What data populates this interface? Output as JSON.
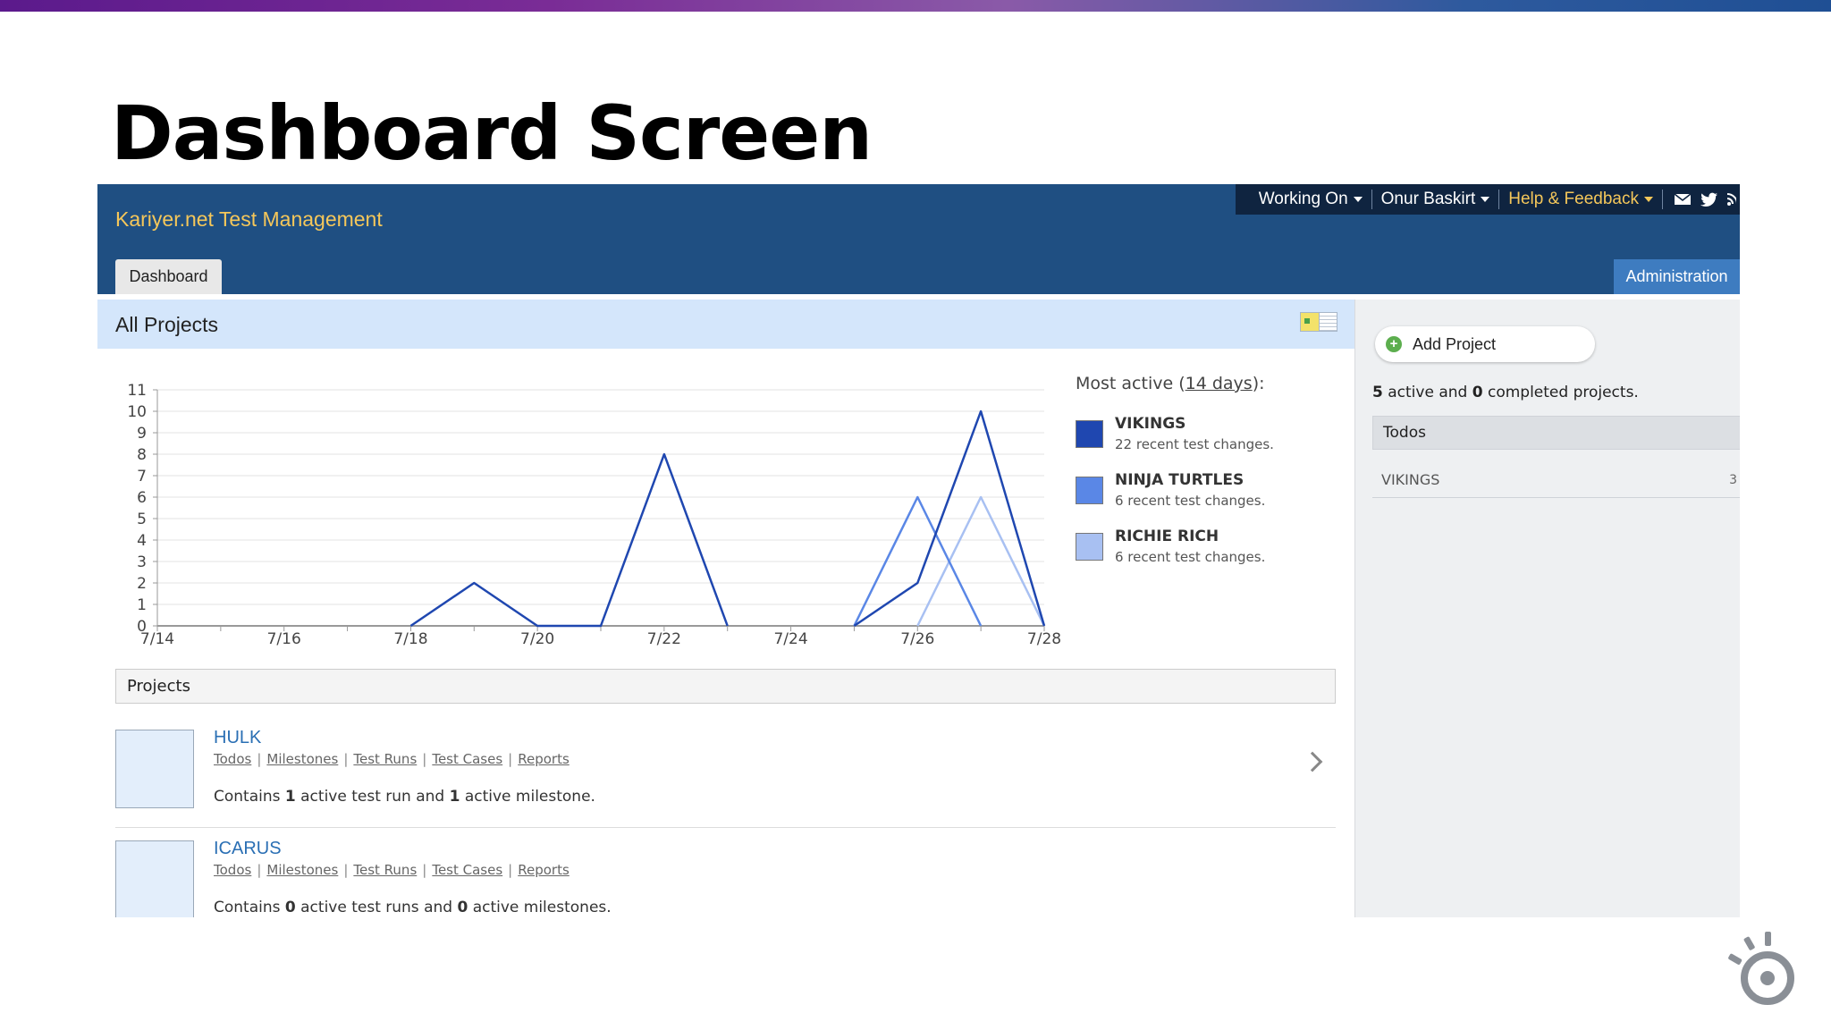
{
  "slide": {
    "title": "Dashboard Screen"
  },
  "app": {
    "name": "Kariyer.net Test Management",
    "topnav": {
      "working_on": "Working On",
      "user": "Onur Baskirt",
      "help": "Help & Feedback"
    },
    "tabs": {
      "dashboard": "Dashboard",
      "administration": "Administration"
    },
    "section_title": "All Projects"
  },
  "legend": {
    "prefix": "Most active (",
    "period": "14 days",
    "suffix": "):",
    "entries": [
      {
        "name": "VIKINGS",
        "changes": "22 recent test changes.",
        "color": "#1f47b0"
      },
      {
        "name": "NINJA TURTLES",
        "changes": "6 recent test changes.",
        "color": "#5a87e6"
      },
      {
        "name": "RICHIE RICH",
        "changes": "6 recent test changes.",
        "color": "#a8c0f2"
      }
    ]
  },
  "chart_data": {
    "type": "line",
    "x": [
      "7/14",
      "7/15",
      "7/16",
      "7/17",
      "7/18",
      "7/19",
      "7/20",
      "7/21",
      "7/22",
      "7/23",
      "7/24",
      "7/25",
      "7/26",
      "7/27",
      "7/28"
    ],
    "x_tick_labels": [
      "7/14",
      "7/16",
      "7/18",
      "7/20",
      "7/22",
      "7/24",
      "7/26",
      "7/28"
    ],
    "ylim": [
      0,
      11
    ],
    "y_ticks": [
      0,
      1,
      2,
      3,
      4,
      5,
      6,
      7,
      8,
      9,
      10,
      11
    ],
    "grid": true,
    "series": [
      {
        "name": "VIKINGS",
        "color": "#1f47b0",
        "values": [
          0,
          0,
          0,
          0,
          0,
          2,
          0,
          0,
          8,
          0,
          0,
          0,
          2,
          10,
          0
        ]
      },
      {
        "name": "NINJA TURTLES",
        "color": "#5a87e6",
        "values": [
          0,
          0,
          0,
          0,
          0,
          0,
          0,
          0,
          0,
          0,
          0,
          0,
          6,
          0,
          0
        ]
      },
      {
        "name": "RICHIE RICH",
        "color": "#a8c0f2",
        "values": [
          0,
          0,
          0,
          0,
          0,
          0,
          0,
          0,
          0,
          0,
          0,
          0,
          0,
          6,
          0
        ]
      }
    ]
  },
  "projects": {
    "header": "Projects",
    "links": [
      "Todos",
      "Milestones",
      "Test Runs",
      "Test Cases",
      "Reports"
    ],
    "items": [
      {
        "name": "HULK",
        "desc_pre": "Contains ",
        "n1": "1",
        "desc_mid": " active test run and ",
        "n2": "1",
        "desc_post": " active milestone."
      },
      {
        "name": "ICARUS",
        "desc_pre": "Contains ",
        "n1": "0",
        "desc_mid": " active test runs and ",
        "n2": "0",
        "desc_post": " active milestones."
      }
    ]
  },
  "sidebar": {
    "add_project": "Add Project",
    "summary_n1": "5",
    "summary_mid": " active and ",
    "summary_n2": "0",
    "summary_post": " completed projects.",
    "todos_header": "Todos",
    "todo_items": [
      {
        "name": "VIKINGS",
        "count": "3"
      }
    ]
  }
}
